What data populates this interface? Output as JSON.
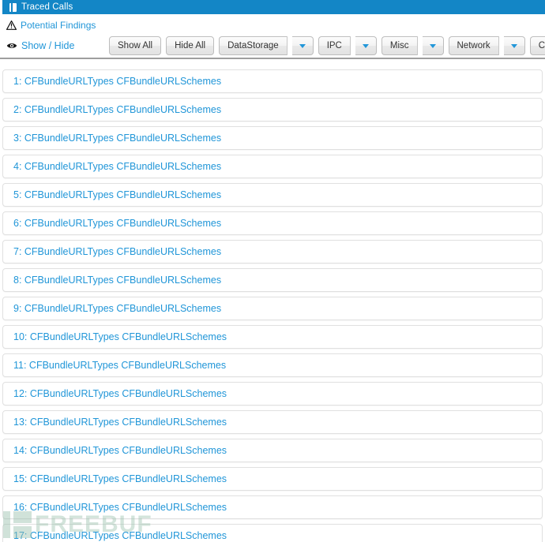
{
  "titlebar": {
    "title": "Traced Calls",
    "icon": "document-icon",
    "background_color": "#1386c6",
    "text_color": "#ffffff"
  },
  "toolbar": {
    "findings": {
      "icon": "warning-triangle-icon",
      "label": "Potential Findings"
    },
    "show_hide": {
      "icon": "eye-icon",
      "label": "Show / Hide"
    },
    "buttons": [
      {
        "label": "Show All",
        "has_dropdown": false
      },
      {
        "label": "Hide All",
        "has_dropdown": false
      }
    ],
    "dropdown_buttons": [
      {
        "label": "DataStorage",
        "has_dropdown": true,
        "caret": "chevron-down-icon"
      },
      {
        "label": "IPC",
        "has_dropdown": true,
        "caret": "chevron-down-icon"
      },
      {
        "label": "Misc",
        "has_dropdown": true,
        "caret": "chevron-down-icon"
      },
      {
        "label": "Network",
        "has_dropdown": true,
        "caret": "chevron-down-icon"
      },
      {
        "label": "Crypto",
        "has_dropdown": true,
        "caret": "chevron-down-icon"
      }
    ],
    "link_color": "#2196d8"
  },
  "list": {
    "items": [
      {
        "text": "1: CFBundleURLTypes CFBundleURLSchemes"
      },
      {
        "text": "2: CFBundleURLTypes CFBundleURLSchemes"
      },
      {
        "text": "3: CFBundleURLTypes CFBundleURLSchemes"
      },
      {
        "text": "4: CFBundleURLTypes CFBundleURLSchemes"
      },
      {
        "text": "5: CFBundleURLTypes CFBundleURLSchemes"
      },
      {
        "text": "6: CFBundleURLTypes CFBundleURLSchemes"
      },
      {
        "text": "7: CFBundleURLTypes CFBundleURLSchemes"
      },
      {
        "text": "8: CFBundleURLTypes CFBundleURLSchemes"
      },
      {
        "text": "9: CFBundleURLTypes CFBundleURLSchemes"
      },
      {
        "text": "10: CFBundleURLTypes CFBundleURLSchemes"
      },
      {
        "text": "11: CFBundleURLTypes CFBundleURLSchemes"
      },
      {
        "text": "12: CFBundleURLTypes CFBundleURLSchemes"
      },
      {
        "text": "13: CFBundleURLTypes CFBundleURLSchemes"
      },
      {
        "text": "14: CFBundleURLTypes CFBundleURLSchemes"
      },
      {
        "text": "15: CFBundleURLTypes CFBundleURLSchemes"
      },
      {
        "text": "16: CFBundleURLTypes CFBundleURLSchemes"
      },
      {
        "text": "17: CFBundleURLTypes CFBundleURLSchemes"
      }
    ],
    "text_color": "#2196d8"
  },
  "watermark": {
    "text": "FREEBUF"
  }
}
